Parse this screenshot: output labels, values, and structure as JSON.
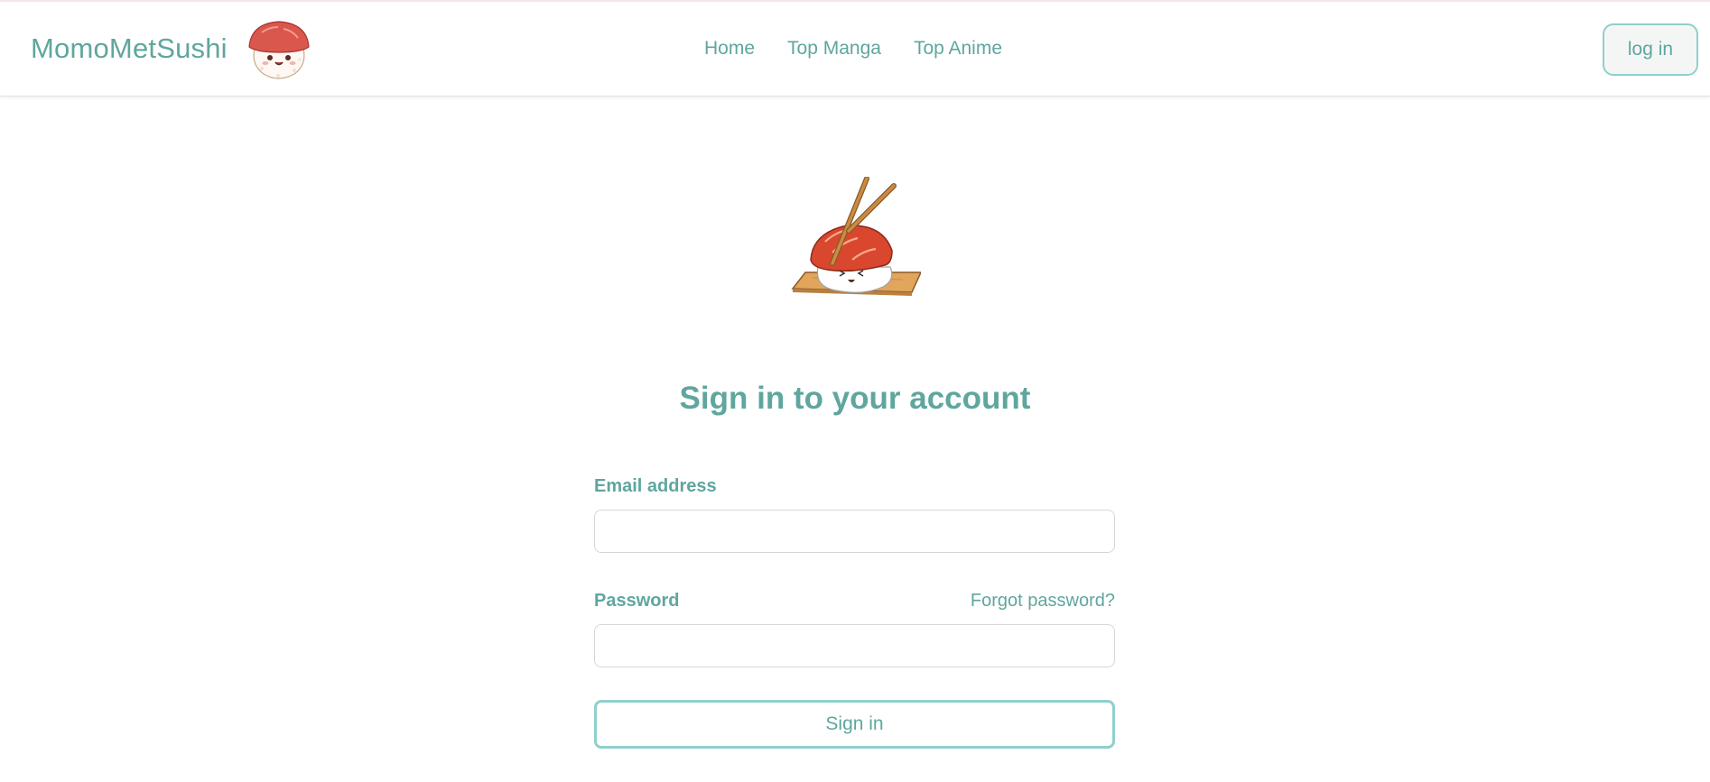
{
  "nav": {
    "brand": "MomoMetSushi",
    "links": [
      "Home",
      "Top Manga",
      "Top Anime"
    ],
    "login_label": "log in"
  },
  "form": {
    "title": "Sign in to your account",
    "email_label": "Email address",
    "email_value": "",
    "password_label": "Password",
    "password_value": "",
    "forgot_label": "Forgot password?",
    "submit_label": "Sign in"
  },
  "colors": {
    "accent": "#5fa69e",
    "button_border": "#8fd0cb",
    "salmon": "#d9472e",
    "rice": "#ffffff",
    "board": "#e1a65c"
  },
  "icons": {
    "brand_logo": "sushi-mascot-icon",
    "hero": "sushi-chopsticks-illustration"
  }
}
